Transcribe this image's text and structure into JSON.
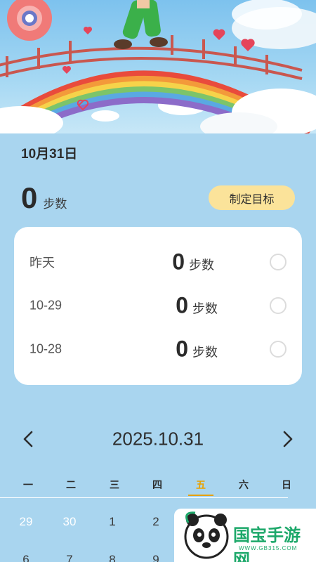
{
  "header": {
    "date_title": "10月31日",
    "today_steps": "0",
    "steps_unit": "步数",
    "goal_button_label": "制定目标"
  },
  "history": [
    {
      "day": "昨天",
      "steps": "0",
      "unit": "步数"
    },
    {
      "day": "10-29",
      "steps": "0",
      "unit": "步数"
    },
    {
      "day": "10-28",
      "steps": "0",
      "unit": "步数"
    }
  ],
  "calendar": {
    "current_date": "2025.10.31",
    "weekdays": [
      "一",
      "二",
      "三",
      "四",
      "五",
      "六",
      "日"
    ],
    "active_weekday": "五",
    "rows": [
      [
        "29",
        "30",
        "1",
        "2"
      ],
      [
        "6",
        "7",
        "8",
        "9"
      ]
    ],
    "accent_color": "#e8a100"
  },
  "watermark": {
    "brand": "国宝手游网",
    "site": "WWW.GB315.COM"
  },
  "icons": {
    "prev": "chevron-left-icon",
    "next": "chevron-right-icon"
  }
}
